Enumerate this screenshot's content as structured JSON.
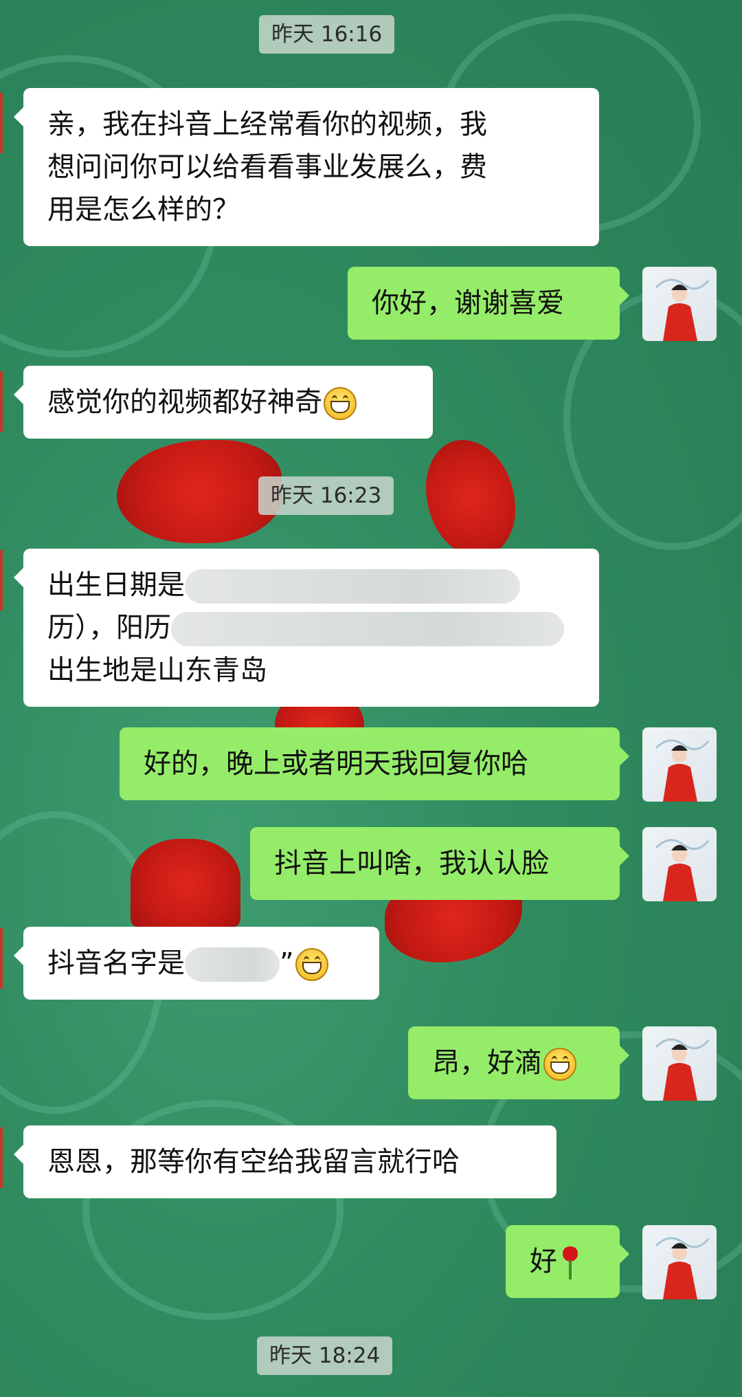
{
  "timestamps": [
    "昨天 16:16",
    "昨天 16:23",
    "昨天 18:24"
  ],
  "messages": [
    {
      "side": "left",
      "lines": [
        "亲，我在抖音上经常看你的视频，我",
        "想问问你可以给看看事业发展么，费",
        "用是怎么样的？"
      ]
    },
    {
      "side": "right",
      "text": "你好，谢谢喜爱"
    },
    {
      "side": "left",
      "text": "感觉你的视频都好神奇",
      "emoji": "grinning-face"
    },
    {
      "side": "left",
      "lines": [
        "出生日期是",
        "历），阳历",
        "出生地是山东青岛"
      ],
      "redacted": true
    },
    {
      "side": "right",
      "text": "好的，晚上或者明天我回复你哈"
    },
    {
      "side": "right",
      "text": "抖音上叫啥，我认认脸"
    },
    {
      "side": "left",
      "text": "抖音名字是",
      "suffix": "”",
      "emoji": "grinning-face",
      "redacted": true
    },
    {
      "side": "right",
      "text": "昂，好滴",
      "emoji": "grinning-face"
    },
    {
      "side": "left",
      "text": "恩恩，那等你有空给我留言就行哈"
    },
    {
      "side": "right",
      "text": "好",
      "emoji": "rose"
    }
  ],
  "colors": {
    "background": "#2f8a5e",
    "bubble_sent": "#95ec69",
    "bubble_received": "#ffffff",
    "timestamp_bg": "#c8d6cc"
  },
  "icons": [
    "avatar-icon",
    "grinning-face-emoji",
    "rose-emoji"
  ]
}
